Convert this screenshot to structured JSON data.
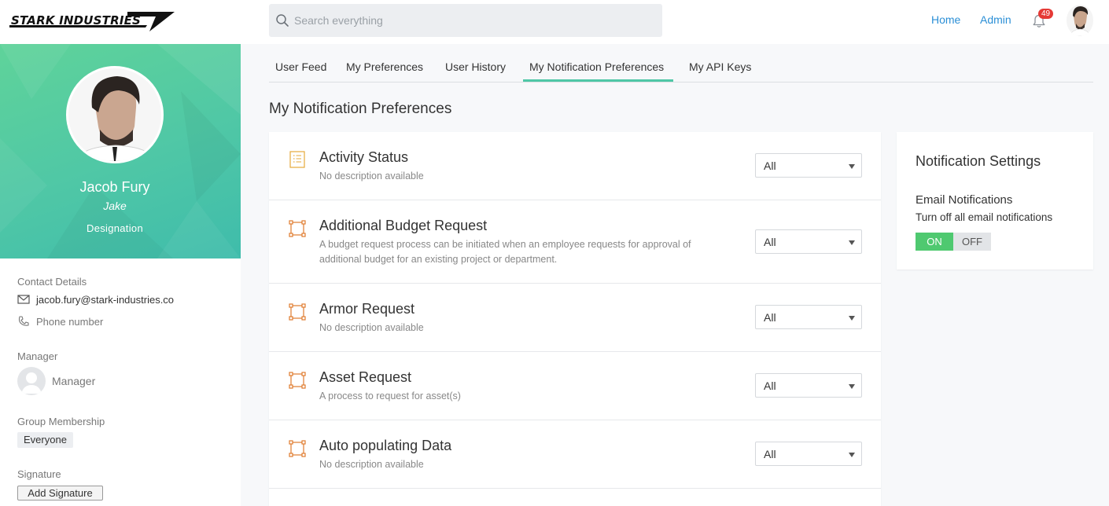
{
  "header": {
    "logo_text": "STARK INDUSTRIES",
    "search_placeholder": "Search everything",
    "nav": {
      "home": "Home",
      "admin": "Admin"
    },
    "notification_count": "49"
  },
  "profile": {
    "name": "Jacob Fury",
    "nickname": "Jake",
    "designation": "Designation"
  },
  "sidebar": {
    "contact_label": "Contact Details",
    "email": "jacob.fury@stark-industries.co",
    "phone_placeholder": "Phone number",
    "manager_label": "Manager",
    "manager_name": "Manager",
    "group_label": "Group Membership",
    "group_name": "Everyone",
    "signature_label": "Signature",
    "add_signature": "Add Signature"
  },
  "tabs": [
    {
      "label": "User Feed"
    },
    {
      "label": "My Preferences"
    },
    {
      "label": "User History"
    },
    {
      "label": "My Notification Preferences",
      "active": true
    },
    {
      "label": "My API Keys"
    }
  ],
  "page_title": "My Notification Preferences",
  "items": [
    {
      "title": "Activity Status",
      "description": "No description available",
      "value": "All",
      "icon": "checklist-icon"
    },
    {
      "title": "Additional Budget Request",
      "description": "A budget request process can be initiated when an employee requests for approval of additional budget for an existing project or department.",
      "value": "All",
      "icon": "process-icon"
    },
    {
      "title": "Armor Request",
      "description": "No description available",
      "value": "All",
      "icon": "process-icon"
    },
    {
      "title": "Asset Request",
      "description": "A process to request for asset(s)",
      "value": "All",
      "icon": "process-icon"
    },
    {
      "title": "Auto populating Data",
      "description": "No description available",
      "value": "All",
      "icon": "process-icon"
    }
  ],
  "settings": {
    "title": "Notification Settings",
    "email_label": "Email Notifications",
    "email_desc": "Turn off all email notifications",
    "on_label": "ON",
    "off_label": "OFF",
    "email_enabled": true
  },
  "colors": {
    "accent": "#4fc7a6",
    "link": "#2b8fd6",
    "badge": "#e53935",
    "toggle_on": "#4fc970",
    "icon_orange": "#e07b2e",
    "icon_yellow": "#e6a93b"
  }
}
